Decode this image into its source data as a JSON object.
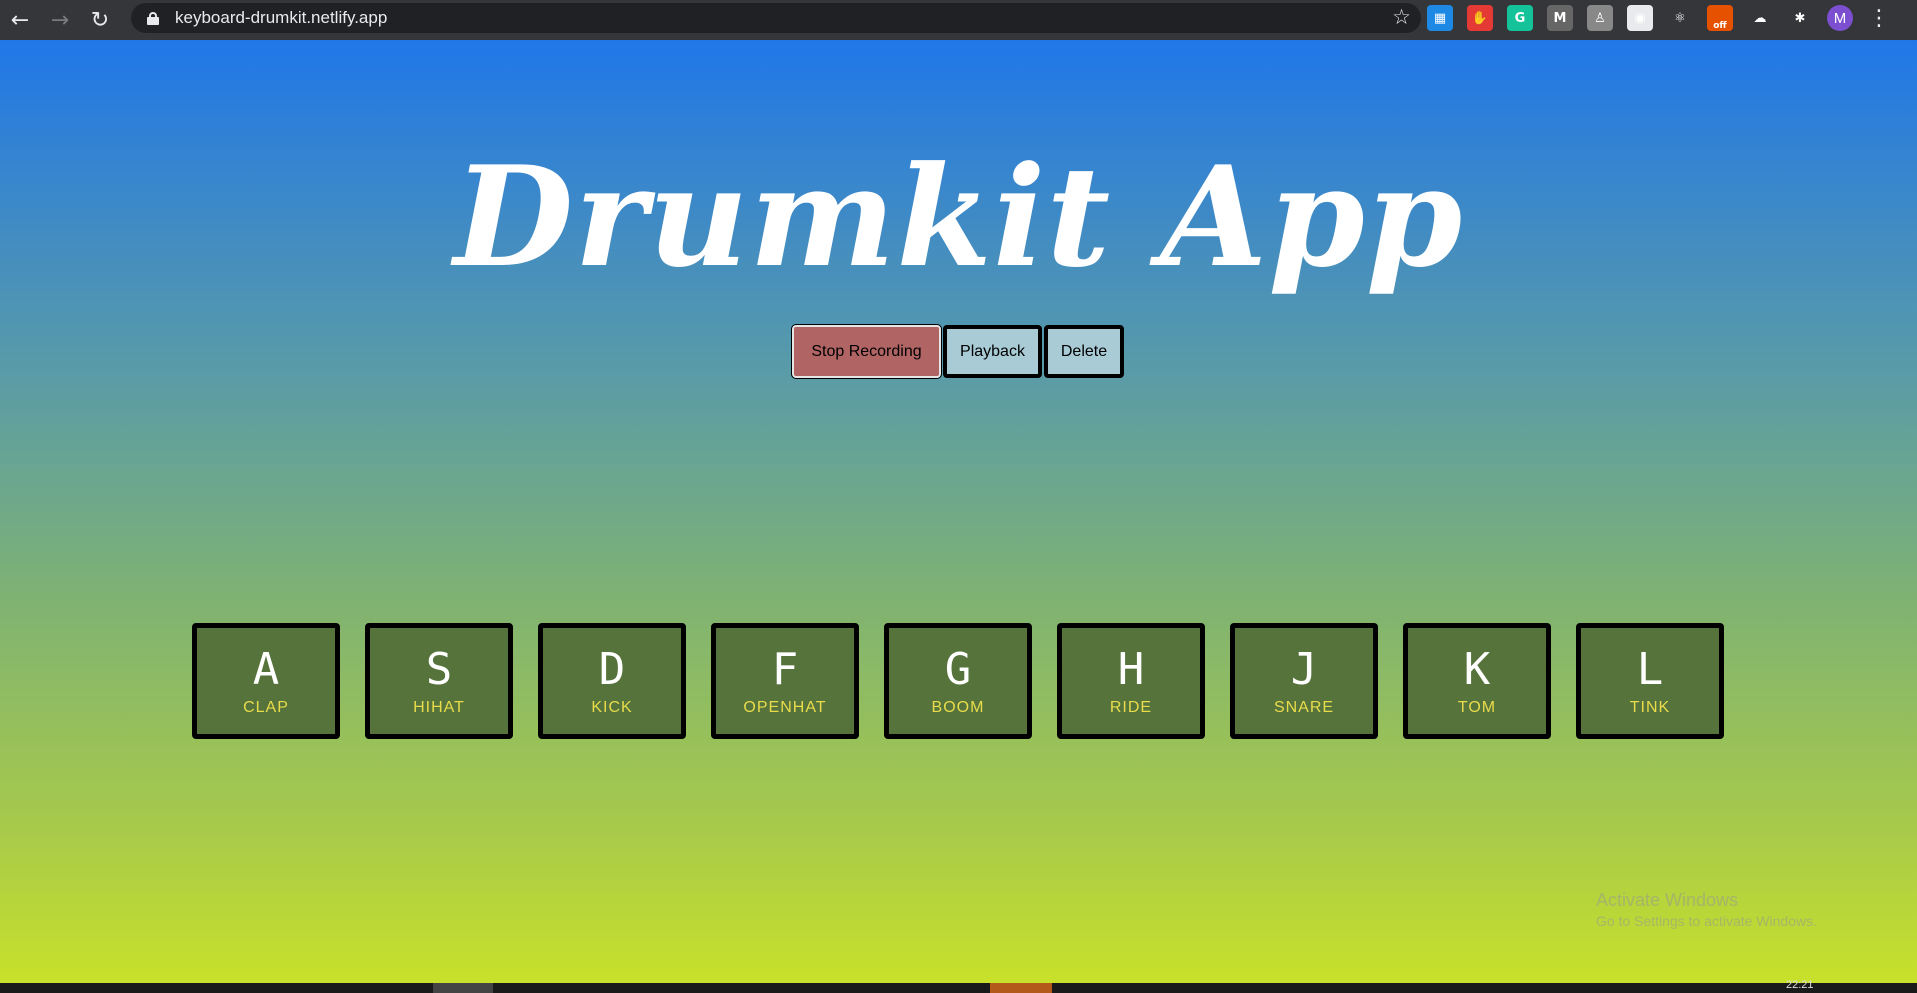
{
  "browser": {
    "url": "keyboard-drumkit.netlify.app",
    "back_icon": "←",
    "forward_icon": "→",
    "reload_icon": "↻",
    "star_icon": "☆",
    "menu_icon": "⋮",
    "extensions": [
      {
        "name": "trello-icon",
        "glyph": "▦",
        "color": "#1e88e5"
      },
      {
        "name": "adblock-icon",
        "glyph": "✋",
        "color": "#e53935"
      },
      {
        "name": "grammarly-icon",
        "glyph": "G",
        "color": "#15c39a"
      },
      {
        "name": "mailtrack-icon",
        "glyph": "M",
        "color": "#666666"
      },
      {
        "name": "ext-figure-icon",
        "glyph": "♙",
        "color": "#888888"
      },
      {
        "name": "ext-circle-icon",
        "glyph": "◉",
        "color": "#e8eaed"
      },
      {
        "name": "react-devtools-icon",
        "glyph": "⚛",
        "color": "#35363a"
      },
      {
        "name": "pdf-off-icon",
        "glyph": "off",
        "color": "#e65100"
      },
      {
        "name": "ext-cloud-icon",
        "glyph": "☁",
        "color": "#35363a"
      },
      {
        "name": "puzzle-icon",
        "glyph": "✱",
        "color": "#35363a"
      }
    ],
    "avatar_initial": "M"
  },
  "app": {
    "title": "Drumkit App",
    "buttons": {
      "record": "Stop Recording",
      "playback": "Playback",
      "delete": "Delete"
    },
    "colors": {
      "record_bg": "#b06464",
      "button_bg": "#a9cbd6",
      "key_bg": "#56733c",
      "key_sound": "#e9dc4a"
    },
    "keys": [
      {
        "letter": "A",
        "sound": "CLAP"
      },
      {
        "letter": "S",
        "sound": "HIHAT"
      },
      {
        "letter": "D",
        "sound": "KICK"
      },
      {
        "letter": "F",
        "sound": "OPENHAT"
      },
      {
        "letter": "G",
        "sound": "BOOM"
      },
      {
        "letter": "H",
        "sound": "RIDE"
      },
      {
        "letter": "J",
        "sound": "SNARE"
      },
      {
        "letter": "K",
        "sound": "TOM"
      },
      {
        "letter": "L",
        "sound": "TINK"
      }
    ]
  },
  "watermark": {
    "line1": "Activate Windows",
    "line2": "Go to Settings to activate Windows."
  },
  "taskbar": {
    "clock": "22:21"
  }
}
